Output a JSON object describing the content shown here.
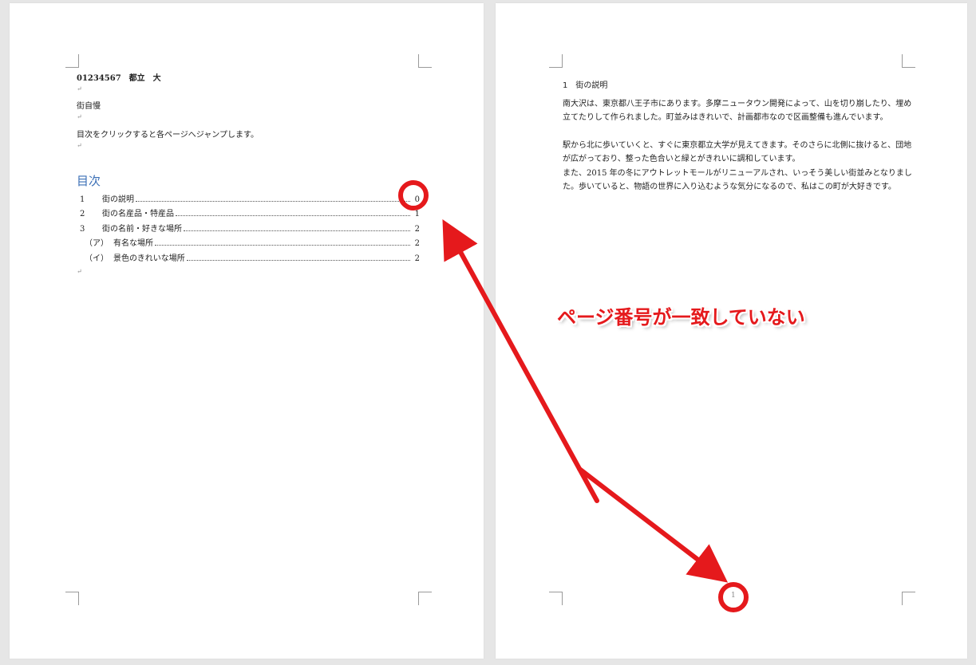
{
  "left_page": {
    "header": {
      "line1": "01234567　都立　大",
      "line2": "街自慢",
      "line3": "目次をクリックすると各ページへジャンプします。"
    },
    "toc": {
      "title": "目次",
      "entries": [
        {
          "num": "1",
          "label": "街の説明",
          "page": "0"
        },
        {
          "num": "2",
          "label": "街の名産品・特産品",
          "page": "1"
        },
        {
          "num": "3",
          "label": "街の名前・好きな場所",
          "page": "2"
        },
        {
          "num": "（ア）",
          "label": "有名な場所",
          "page": "2"
        },
        {
          "num": "（イ）",
          "label": "景色のきれいな場所",
          "page": "2"
        }
      ]
    }
  },
  "right_page": {
    "heading": "1　街の説明",
    "paragraphs": [
      "南大沢は、東京都八王子市にあります。多摩ニュータウン開発によって、山を切り崩したり、埋め立てたりして作られました。町並みはきれいで、計画都市なので区画整備も進んでいます。",
      "駅から北に歩いていくと、すぐに東京都立大学が見えてきます。そのさらに北側に抜けると、団地が広がっており、整った色合いと緑とがきれいに調和しています。",
      "また、2015 年の冬にアウトレットモールがリニューアルされ、いっそう美しい街並みとなりました。歩いていると、物語の世界に入り込むような気分になるので、私はこの町が大好きです。"
    ],
    "page_number": "1"
  },
  "annotation": {
    "text": "ページ番号が一致していない",
    "color": "#e5191c"
  }
}
